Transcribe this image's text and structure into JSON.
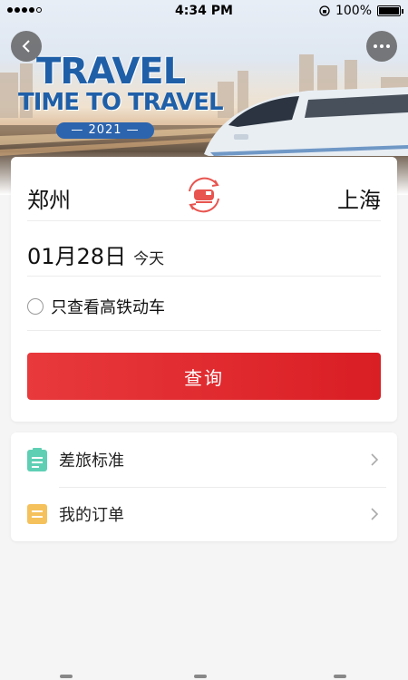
{
  "status_bar": {
    "time": "4:34 PM",
    "battery": "100%"
  },
  "banner": {
    "title": "TRAVEL",
    "subtitle": "TIME TO TRAVEL",
    "year": "— 2021 —"
  },
  "nav": {
    "back_icon": "chevron-left-icon",
    "more_icon": "more-dots-icon"
  },
  "route": {
    "from": "郑州",
    "to": "上海",
    "swap_icon": "train-swap-icon"
  },
  "date": {
    "value": "01月28日",
    "relative": "今天"
  },
  "filter": {
    "label": "只查看高铁动车",
    "checked": false
  },
  "search_button": {
    "label": "查询"
  },
  "menu": [
    {
      "label": "差旅标准",
      "icon": "document-icon",
      "icon_color": "#5fcfb4"
    },
    {
      "label": "我的订单",
      "icon": "order-icon",
      "icon_color": "#f5c15b"
    }
  ],
  "colors": {
    "accent": "#e02a2e",
    "banner_blue": "#1f5fa8"
  }
}
